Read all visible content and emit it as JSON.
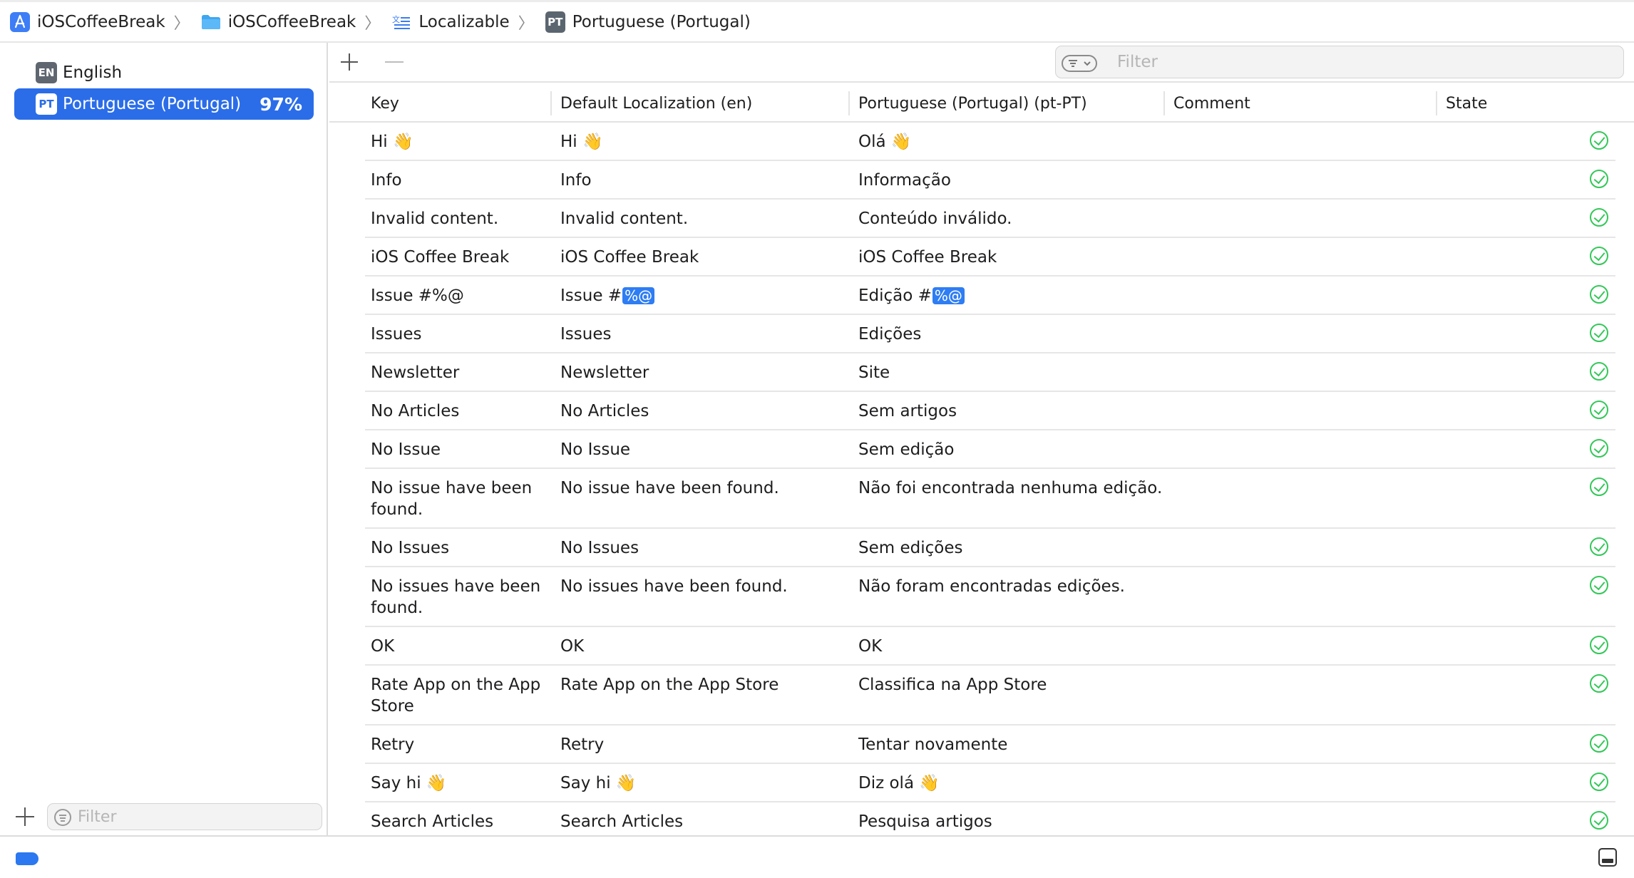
{
  "breadcrumb": [
    {
      "label": "iOSCoffeeBreak",
      "icon": "app-icon"
    },
    {
      "label": "iOSCoffeeBreak",
      "icon": "folder-icon"
    },
    {
      "label": "Localizable",
      "icon": "strings-file-icon"
    },
    {
      "label": "Portuguese (Portugal)",
      "icon": "language-pt-icon",
      "badge": "PT"
    }
  ],
  "sidebar": {
    "languages": [
      {
        "badge": "EN",
        "label": "English",
        "percent": "",
        "selected": false
      },
      {
        "badge": "PT",
        "label": "Portuguese (Portugal)",
        "percent": "97%",
        "selected": true
      }
    ],
    "filter_placeholder": "Filter"
  },
  "toolbar": {
    "filter_placeholder": "Filter"
  },
  "table": {
    "columns": [
      "Key",
      "Default Localization (en)",
      "Portuguese (Portugal) (pt-PT)",
      "Comment",
      "State"
    ],
    "rows": [
      {
        "key": "Hi 👋",
        "default": "Hi 👋",
        "pt": "Olá 👋",
        "comment": "",
        "state": "translated"
      },
      {
        "key": "Info",
        "default": "Info",
        "pt": "Informação",
        "comment": "",
        "state": "translated"
      },
      {
        "key": "Invalid content.",
        "default": "Invalid content.",
        "pt": "Conteúdo inválido.",
        "comment": "",
        "state": "translated"
      },
      {
        "key": "iOS Coffee Break",
        "default": "iOS Coffee Break",
        "pt": "iOS Coffee Break",
        "comment": "",
        "state": "translated"
      },
      {
        "key": "Issue #%@",
        "default": "Issue #",
        "default_token": "%@",
        "pt": "Edição #",
        "pt_token": "%@",
        "comment": "",
        "state": "translated"
      },
      {
        "key": "Issues",
        "default": "Issues",
        "pt": "Edições",
        "comment": "",
        "state": "translated"
      },
      {
        "key": "Newsletter",
        "default": "Newsletter",
        "pt": "Site",
        "comment": "",
        "state": "translated"
      },
      {
        "key": "No Articles",
        "default": "No Articles",
        "pt": "Sem artigos",
        "comment": "",
        "state": "translated"
      },
      {
        "key": "No Issue",
        "default": "No Issue",
        "pt": "Sem edição",
        "comment": "",
        "state": "translated"
      },
      {
        "key": "No issue have been found.",
        "default": "No issue have been found.",
        "pt": "Não foi encontrada nenhuma edição.",
        "comment": "",
        "state": "translated"
      },
      {
        "key": "No Issues",
        "default": "No Issues",
        "pt": "Sem edições",
        "comment": "",
        "state": "translated"
      },
      {
        "key": "No issues have been found.",
        "default": "No issues have been found.",
        "pt": "Não foram encontradas edições.",
        "comment": "",
        "state": "translated"
      },
      {
        "key": "OK",
        "default": "OK",
        "pt": "OK",
        "comment": "",
        "state": "translated"
      },
      {
        "key": "Rate App on the App Store",
        "default": "Rate App on the App Store",
        "pt": "Classifica na App Store",
        "comment": "",
        "state": "translated"
      },
      {
        "key": "Retry",
        "default": "Retry",
        "pt": "Tentar novamente",
        "comment": "",
        "state": "translated"
      },
      {
        "key": "Say hi 👋",
        "default": "Say hi 👋",
        "pt": "Diz olá 👋",
        "comment": "",
        "state": "translated"
      },
      {
        "key": "Search Articles",
        "default": "Search Articles",
        "pt": "Pesquisa artigos",
        "comment": "",
        "state": "translated"
      }
    ]
  },
  "colors": {
    "accent": "#2b6de8",
    "state_ok": "#34c759",
    "token": "#2e7df3"
  }
}
